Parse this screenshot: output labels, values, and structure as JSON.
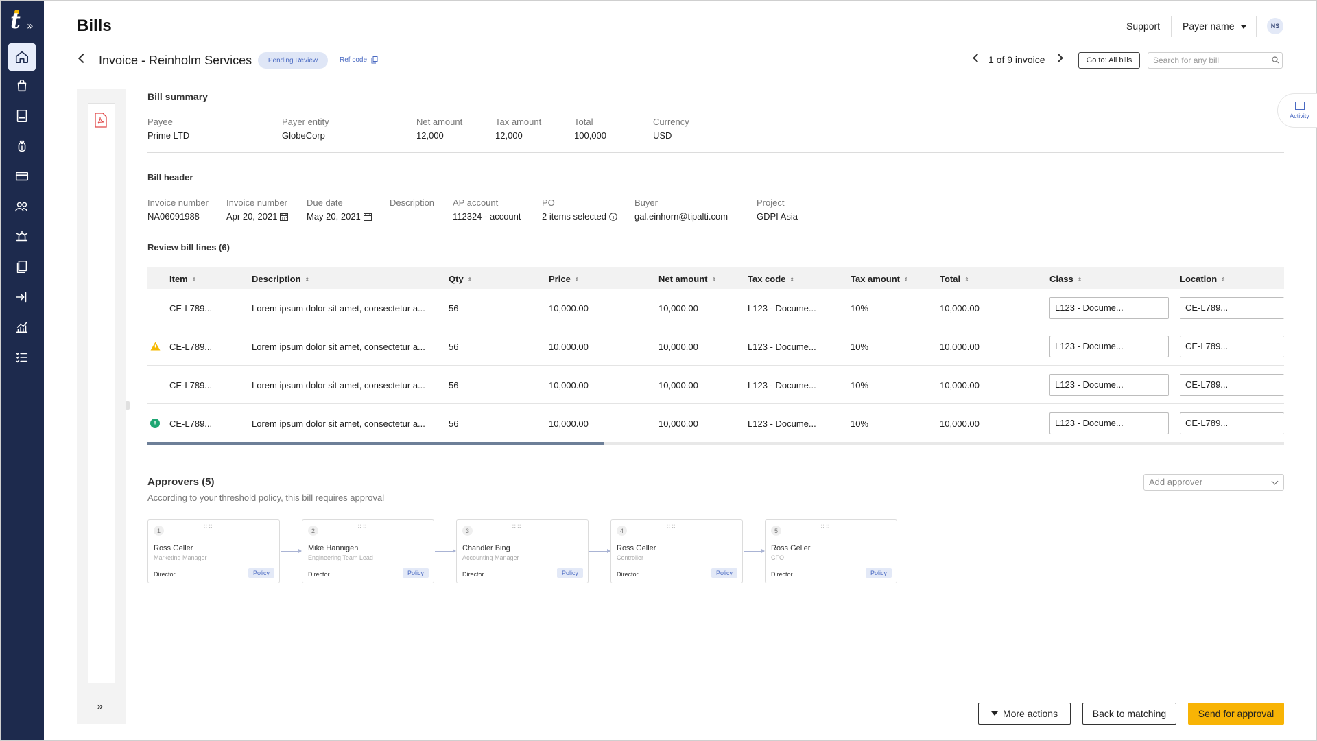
{
  "app": {
    "title": "Bills",
    "logo_letter": "t",
    "expand_glyph": "»"
  },
  "sidebar": {
    "items": [
      {
        "name": "home",
        "icon": "home-icon",
        "active": true
      },
      {
        "name": "purchases",
        "icon": "shopping-bag-icon"
      },
      {
        "name": "bills",
        "icon": "document-icon"
      },
      {
        "name": "money",
        "icon": "money-bag-icon"
      },
      {
        "name": "cards",
        "icon": "credit-card-icon"
      },
      {
        "name": "payees",
        "icon": "users-icon"
      },
      {
        "name": "alerts",
        "icon": "alarm-icon"
      },
      {
        "name": "documents",
        "icon": "files-icon"
      },
      {
        "name": "transfers",
        "icon": "transfer-icon"
      },
      {
        "name": "reports",
        "icon": "chart-icon"
      },
      {
        "name": "tasks",
        "icon": "checklist-icon"
      }
    ]
  },
  "header": {
    "support": "Support",
    "payer_name": "Payer name",
    "avatar_initials": "NS"
  },
  "invoice": {
    "title": "Invoice - Reinholm Services",
    "status": "Pending Review",
    "ref_code": "Ref code",
    "pager_text": "1 of 9 invoice",
    "goto_label": "Go to: All bills",
    "search_placeholder": "Search for any bill"
  },
  "activity": {
    "label": "Activity"
  },
  "summary": {
    "title": "Bill summary",
    "fields": [
      {
        "label": "Payee",
        "value": "Prime LTD"
      },
      {
        "label": "Payer entity",
        "value": "GlobeCorp"
      },
      {
        "label": "Net amount",
        "value": "12,000"
      },
      {
        "label": "Tax amount",
        "value": "12,000"
      },
      {
        "label": "Total",
        "value": "100,000"
      },
      {
        "label": "Currency",
        "value": "USD"
      }
    ]
  },
  "bill_header": {
    "title": "Bill header",
    "fields": [
      {
        "label": "Invoice number",
        "value": "NA06091988"
      },
      {
        "label": "Invoice number",
        "value": "Apr 20, 2021"
      },
      {
        "label": "Due date",
        "value": "May 20, 2021"
      },
      {
        "label": "Description",
        "value": ""
      },
      {
        "label": "AP account",
        "value": "112324 -  account"
      },
      {
        "label": "PO",
        "value": "2 items selected"
      },
      {
        "label": "Buyer",
        "value": "gal.einhorn@tipalti.com"
      },
      {
        "label": "Project",
        "value": "GDPI Asia"
      }
    ]
  },
  "lines": {
    "title": "Review bill lines (6)",
    "columns": [
      "Item",
      "Description",
      "Qty",
      "Price",
      "Net amount",
      "Tax code",
      "Tax amount",
      "Total",
      "Class",
      "Location"
    ],
    "rows": [
      {
        "status": "none",
        "item": "CE-L789...",
        "description": "Lorem ipsum dolor sit amet, consectetur a...",
        "qty": "56",
        "price": "10,000.00",
        "net_amount": "10,000.00",
        "tax_code": "L123 - Docume...",
        "tax_amount": "10%",
        "total": "10,000.00",
        "class": "L123 - Docume...",
        "location": "CE-L789..."
      },
      {
        "status": "warning",
        "item": "CE-L789...",
        "description": "Lorem ipsum dolor sit amet, consectetur a...",
        "qty": "56",
        "price": "10,000.00",
        "net_amount": "10,000.00",
        "tax_code": "L123 - Docume...",
        "tax_amount": "10%",
        "total": "10,000.00",
        "class": "L123 - Docume...",
        "location": "CE-L789..."
      },
      {
        "status": "none",
        "item": "CE-L789...",
        "description": "Lorem ipsum dolor sit amet, consectetur a...",
        "qty": "56",
        "price": "10,000.00",
        "net_amount": "10,000.00",
        "tax_code": "L123 - Docume...",
        "tax_amount": "10%",
        "total": "10,000.00",
        "class": "L123 - Docume...",
        "location": "CE-L789..."
      },
      {
        "status": "ok",
        "item": "CE-L789...",
        "description": "Lorem ipsum dolor sit amet, consectetur a...",
        "qty": "56",
        "price": "10,000.00",
        "net_amount": "10,000.00",
        "tax_code": "L123 - Docume...",
        "tax_amount": "10%",
        "total": "10,000.00",
        "class": "L123 - Docume...",
        "location": "CE-L789..."
      }
    ]
  },
  "approvers": {
    "title": "Approvers (5)",
    "subtitle": "According to your threshold policy, this bill requires approval",
    "add_placeholder": "Add approver",
    "cards": [
      {
        "num": "1",
        "name": "Ross Geller",
        "role": "Marketing Manager",
        "level": "Director",
        "tag": "Policy"
      },
      {
        "num": "2",
        "name": "Mike Hannigen",
        "role": "Engineering Team Lead",
        "level": "Director",
        "tag": "Policy"
      },
      {
        "num": "3",
        "name": "Chandler Bing",
        "role": "Accounting Manager",
        "level": "Director",
        "tag": "Policy"
      },
      {
        "num": "4",
        "name": "Ross Geller",
        "role": "Controller",
        "level": "Director",
        "tag": "Policy"
      },
      {
        "num": "5",
        "name": "Ross Geller",
        "role": "CFO",
        "level": "Director",
        "tag": "Policy"
      }
    ]
  },
  "footer": {
    "more_actions": "More actions",
    "back": "Back to matching",
    "send": "Send for approval"
  },
  "colors": {
    "rail": "#1d2a4d",
    "accent": "#4a6ac2",
    "primary_button": "#f8b405",
    "warning": "#f5b800",
    "success": "#1ea672"
  }
}
